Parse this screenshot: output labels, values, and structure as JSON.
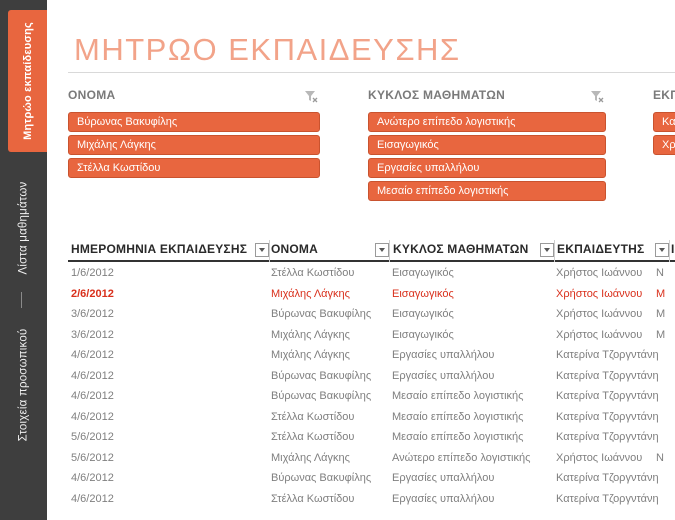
{
  "tabs": [
    {
      "label": "Μητρώο εκπαίδευσης",
      "active": true
    },
    {
      "label": "Λίστα μαθημάτων",
      "active": false
    },
    {
      "label": "Στοιχεία προσωπικού",
      "active": false
    }
  ],
  "title": "ΜΗΤΡΩΟ ΕΚΠΑΙΔΕΥΣΗΣ",
  "slicers": {
    "name": {
      "title": "ΟΝΟΜΑ",
      "items": [
        "Βύρωνας Βακυφίλης",
        "Μιχάλης Λάγκης",
        "Στέλλα Κωστίδου"
      ]
    },
    "course": {
      "title": "ΚΥΚΛΟΣ ΜΑΘΗΜΑΤΩΝ",
      "items": [
        "Ανώτερο επίπεδο λογιστικής",
        "Εισαγωγικός",
        "Εργασίες υπαλλήλου",
        "Μεσαίο επίπεδο λογιστικής"
      ]
    },
    "third": {
      "title": "ΕΚΠ",
      "items": [
        "Κατ",
        "Χρή"
      ]
    }
  },
  "table": {
    "headers": [
      "ΗΜΕΡΟΜΗΝΙΑ ΕΚΠΑΙΔΕΥΣΗΣ",
      "ΟΝΟΜΑ",
      "ΚΥΚΛΟΣ ΜΑΘΗΜΑΤΩΝ",
      "ΕΚΠΑΙΔΕΥΤΗΣ",
      "Ι"
    ],
    "highlight_color": "#d9301c",
    "rows": [
      {
        "date": "1/6/2012",
        "name": "Στέλλα Κωστίδου",
        "course": "Εισαγωγικός",
        "trainer": "Χρήστος Ιωάννου",
        "extra": "Ν",
        "highlight": false
      },
      {
        "date": "2/6/2012",
        "name": "Μιχάλης Λάγκης",
        "course": "Εισαγωγικός",
        "trainer": "Χρήστος Ιωάννου",
        "extra": "Μ",
        "highlight": true
      },
      {
        "date": "3/6/2012",
        "name": "Βύρωνας Βακυφίλης",
        "course": "Εισαγωγικός",
        "trainer": "Χρήστος Ιωάννου",
        "extra": "Μ",
        "highlight": false
      },
      {
        "date": "3/6/2012",
        "name": "Μιχάλης Λάγκης",
        "course": "Εισαγωγικός",
        "trainer": "Χρήστος Ιωάννου",
        "extra": "Μ",
        "highlight": false
      },
      {
        "date": "4/6/2012",
        "name": "Μιχάλης Λάγκης",
        "course": "Εργασίες υπαλλήλου",
        "trainer": "Κατερίνα Τζοργντάνη",
        "extra": "",
        "highlight": false
      },
      {
        "date": "4/6/2012",
        "name": "Βύρωνας Βακυφίλης",
        "course": "Εργασίες υπαλλήλου",
        "trainer": "Κατερίνα Τζοργντάνη",
        "extra": "",
        "highlight": false
      },
      {
        "date": "4/6/2012",
        "name": "Βύρωνας Βακυφίλης",
        "course": "Μεσαίο επίπεδο λογιστικής",
        "trainer": "Κατερίνα Τζοργντάνη",
        "extra": "",
        "highlight": false
      },
      {
        "date": "4/6/2012",
        "name": "Στέλλα Κωστίδου",
        "course": "Μεσαίο επίπεδο λογιστικής",
        "trainer": "Κατερίνα Τζοργντάνη",
        "extra": "",
        "highlight": false
      },
      {
        "date": "5/6/2012",
        "name": "Στέλλα Κωστίδου",
        "course": "Μεσαίο επίπεδο λογιστικής",
        "trainer": "Κατερίνα Τζοργντάνη",
        "extra": "",
        "highlight": false
      },
      {
        "date": "5/6/2012",
        "name": "Μιχάλης Λάγκης",
        "course": "Ανώτερο επίπεδο λογιστικής",
        "trainer": "Χρήστος Ιωάννου",
        "extra": "Ν",
        "highlight": false
      },
      {
        "date": "4/6/2012",
        "name": "Βύρωνας Βακυφίλης",
        "course": "Εργασίες υπαλλήλου",
        "trainer": "Κατερίνα Τζοργντάνη",
        "extra": "",
        "highlight": false
      },
      {
        "date": "4/6/2012",
        "name": "Στέλλα Κωστίδου",
        "course": "Εργασίες υπαλλήλου",
        "trainer": "Κατερίνα Τζοργντάνη",
        "extra": "",
        "highlight": false
      }
    ]
  },
  "icons": {
    "filter_clear": "filter-clear-icon",
    "dropdown": "dropdown-arrow-icon"
  },
  "colors": {
    "accent": "#e8663f",
    "title": "#f2a389",
    "tabbar": "#3e3e3e"
  }
}
